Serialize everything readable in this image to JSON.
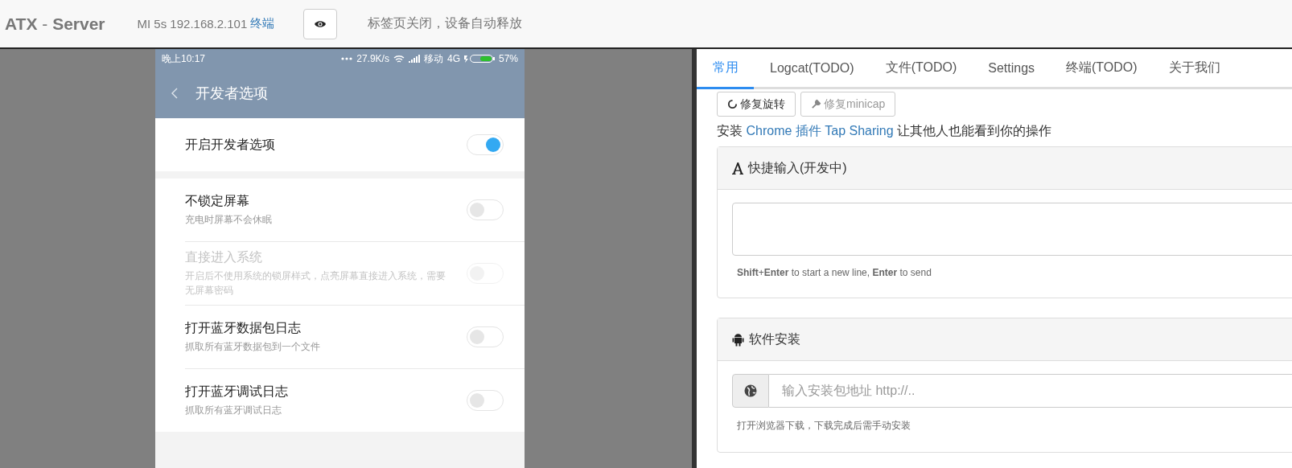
{
  "header": {
    "brand": "ATX",
    "brand_separator": "-",
    "brand_suffix": "Server",
    "device": "MI 5s 192.168.2.101",
    "terminal_link": "终端",
    "notice_link": "标签页关闭",
    "notice_text": "，设备自动释放"
  },
  "phone": {
    "status": {
      "time": "晚上10:17",
      "speed": "27.9K/s",
      "carrier": "移动",
      "network": "4G",
      "battery": "57%"
    },
    "title": "开发者选项",
    "groups": [
      {
        "rows": [
          {
            "title": "开启开发者选项",
            "on": true,
            "disabled": false
          }
        ]
      },
      {
        "rows": [
          {
            "title": "不锁定屏幕",
            "subtitle": "充电时屏幕不会休眠",
            "on": false,
            "disabled": false
          },
          {
            "title": "直接进入系统",
            "subtitle": "开启后不使用系统的锁屏样式，点亮屏幕直接进入系统，需要无屏幕密码",
            "on": false,
            "disabled": true
          },
          {
            "title": "打开蓝牙数据包日志",
            "subtitle": "抓取所有蓝牙数据包到一个文件",
            "on": false,
            "disabled": false
          },
          {
            "title": "打开蓝牙调试日志",
            "subtitle": "抓取所有蓝牙调试日志",
            "on": false,
            "disabled": false
          }
        ]
      }
    ]
  },
  "tabs": [
    {
      "label": "常用",
      "selected": true
    },
    {
      "label": "Logcat(TODO)",
      "selected": false
    },
    {
      "label": "文件(TODO)",
      "selected": false
    },
    {
      "label": "Settings",
      "selected": false
    },
    {
      "label": "终端(TODO)",
      "selected": false
    },
    {
      "label": "关于我们",
      "selected": false
    }
  ],
  "tools": [
    {
      "label": "修复旋转",
      "kind": "rotate"
    },
    {
      "label": "修复minicap",
      "kind": "wrench"
    }
  ],
  "install_note": {
    "before": "安装",
    "link": "Chrome 插件 Tap Sharing",
    "after": "让其他人也能看到你的操作"
  },
  "quick_input": {
    "title": "快捷输入(开发中)",
    "help": "**Shift**+**Enter** to start a new line, **Enter** to send"
  },
  "app_install": {
    "title": "软件安装",
    "placeholder": "输入安装包地址 http://..",
    "help": "打开浏览器下载，下载完成后需手动安装"
  }
}
